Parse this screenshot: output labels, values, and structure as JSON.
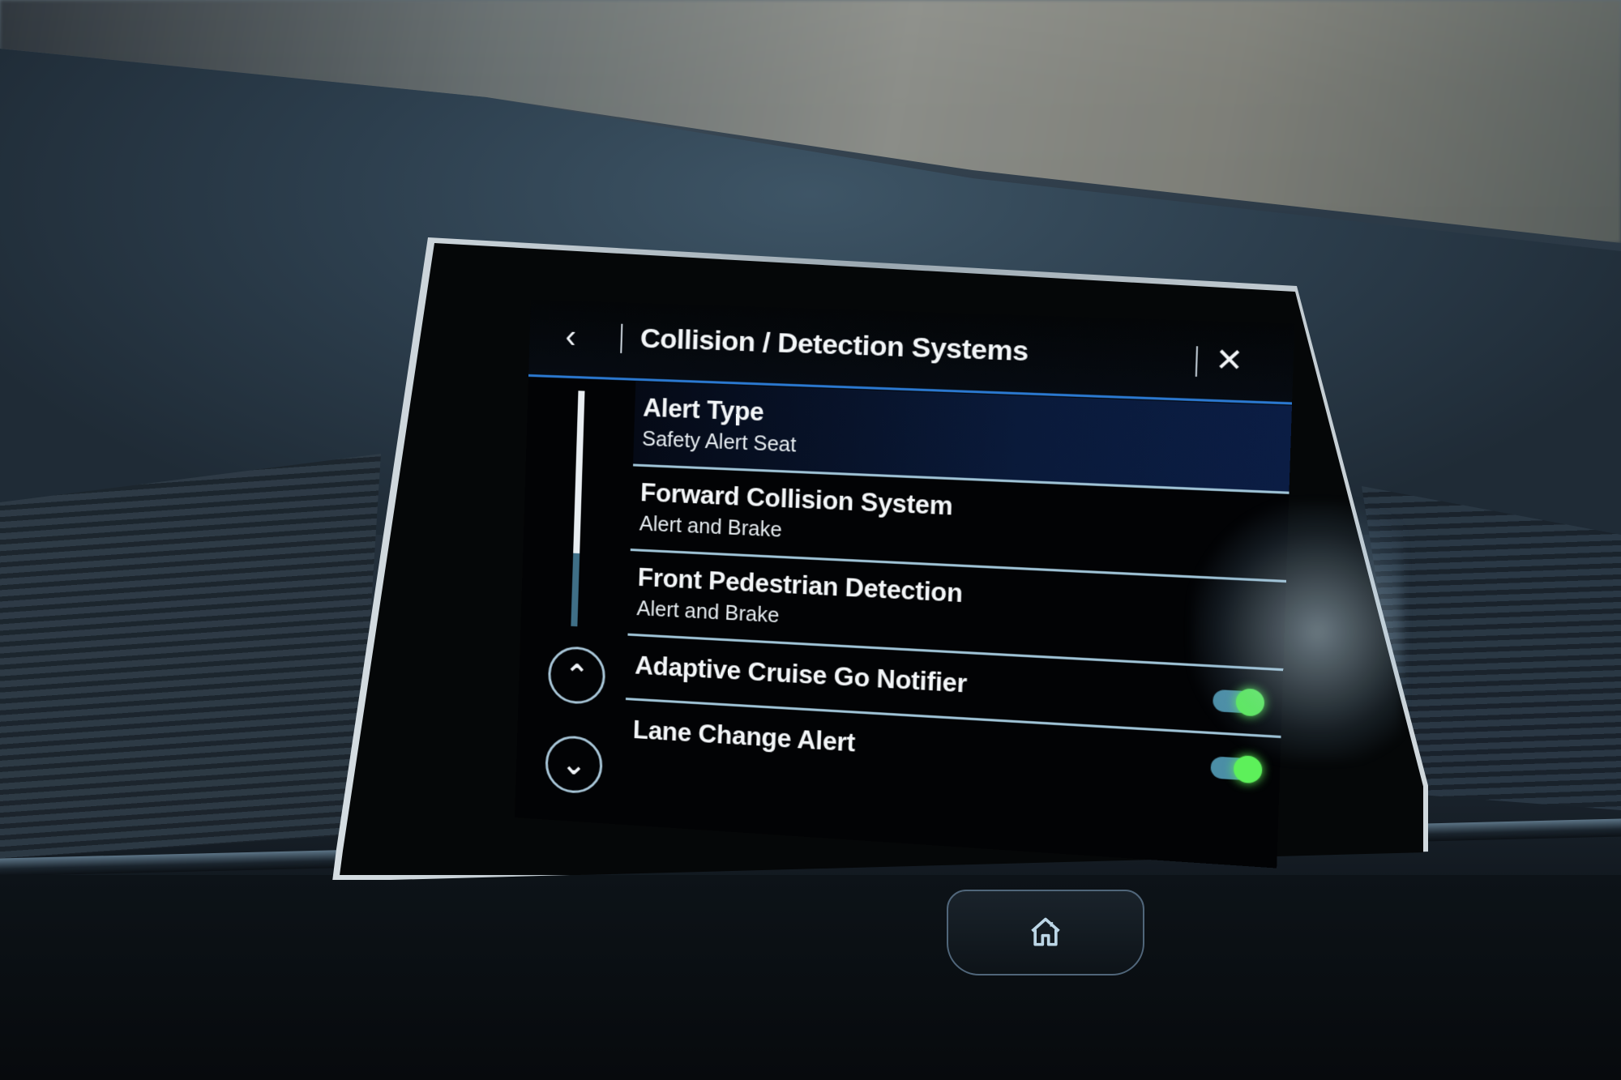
{
  "screen": {
    "header": {
      "back_icon": "chevron-left-icon",
      "title": "Collision / Detection Systems",
      "close_icon": "close-icon"
    },
    "scroll": {
      "up_icon": "chevron-up-icon",
      "down_icon": "chevron-down-icon",
      "position_fraction": 0.0,
      "visible_fraction": 0.7
    },
    "settings": [
      {
        "label": "Alert Type",
        "value": "Safety Alert Seat"
      },
      {
        "label": "Forward Collision System",
        "value": "Alert and Brake"
      },
      {
        "label": "Front Pedestrian Detection",
        "value": "Alert and Brake"
      },
      {
        "label": "Adaptive Cruise Go Notifier",
        "toggle": "on"
      },
      {
        "label": "Lane Change Alert",
        "toggle": "on"
      }
    ],
    "colors": {
      "accent": "#2b79d1",
      "toggle_on": "#5df05a",
      "divider": "#9fc3d6"
    }
  },
  "hardware": {
    "home_button_icon": "home-icon"
  }
}
